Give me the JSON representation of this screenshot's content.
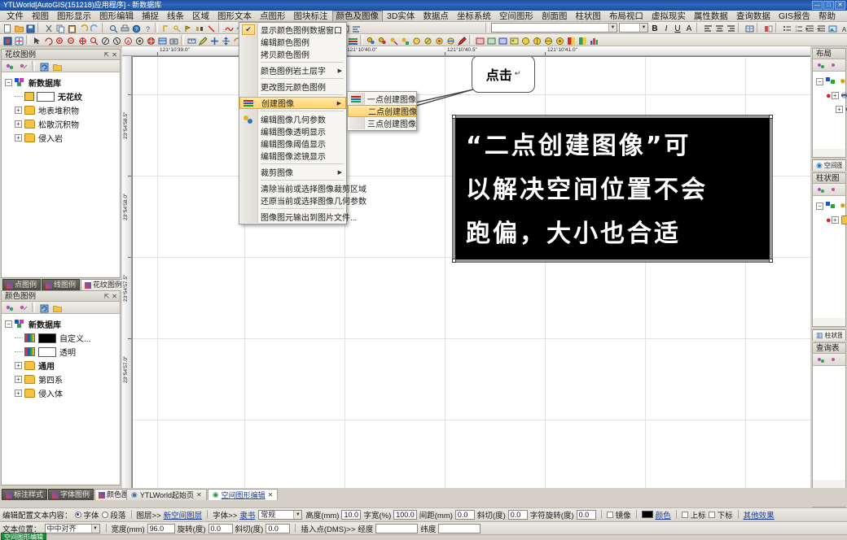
{
  "window": {
    "title": "YTLWorld[AutoGIS(151218)应用程序] - 新数据库",
    "buttons": [
      "—",
      "□",
      "✕"
    ]
  },
  "menubar": {
    "items": [
      {
        "label": "文件",
        "active": false
      },
      {
        "label": "视图",
        "active": false
      },
      {
        "label": "图形显示",
        "active": false
      },
      {
        "label": "图形编辑",
        "active": false
      },
      {
        "label": "捕捉",
        "active": false
      },
      {
        "label": "线条",
        "active": false
      },
      {
        "label": "区域",
        "active": false
      },
      {
        "label": "图形文本",
        "active": false
      },
      {
        "label": "点图形",
        "active": false
      },
      {
        "label": "图块标注",
        "active": false
      },
      {
        "label": "颜色及图像",
        "active": true
      },
      {
        "label": "3D实体",
        "active": false
      },
      {
        "label": "数据点",
        "active": false
      },
      {
        "label": "坐标系统",
        "active": false
      },
      {
        "label": "空间图形",
        "active": false
      },
      {
        "label": "剖面图",
        "active": false
      },
      {
        "label": "柱状图",
        "active": false
      },
      {
        "label": "布局视口",
        "active": false
      },
      {
        "label": "虚拟现实",
        "active": false
      },
      {
        "label": "属性数据",
        "active": false
      },
      {
        "label": "查询数据",
        "active": false
      },
      {
        "label": "GIS报告",
        "active": false
      },
      {
        "label": "帮助",
        "active": false
      }
    ]
  },
  "menu": {
    "title": "颜色及图像",
    "items": [
      {
        "label": "显示颜色图例数据窗口",
        "checked": true,
        "submenu": false,
        "icon": null
      },
      {
        "label": "编辑颜色图例",
        "checked": false,
        "submenu": false,
        "icon": null
      },
      {
        "label": "拷贝颜色图例",
        "checked": false,
        "submenu": false,
        "icon": null
      },
      {
        "separator": true
      },
      {
        "label": "颜色图例岩土层字",
        "checked": false,
        "submenu": true,
        "icon": null
      },
      {
        "separator": true
      },
      {
        "label": "更改图元颜色图例",
        "checked": false,
        "submenu": false,
        "icon": null
      },
      {
        "separator": true
      },
      {
        "label": "创建图像",
        "checked": false,
        "submenu": true,
        "icon": "image-icon",
        "selected": true
      },
      {
        "separator": true
      },
      {
        "label": "编辑图像几何参数",
        "checked": false,
        "submenu": false,
        "icon": "image-geom-icon"
      },
      {
        "label": "编辑图像透明显示",
        "checked": false,
        "submenu": false,
        "icon": null
      },
      {
        "label": "编辑图像阈值显示",
        "checked": false,
        "submenu": false,
        "icon": null
      },
      {
        "label": "编辑图像滤镜显示",
        "checked": false,
        "submenu": false,
        "icon": null
      },
      {
        "separator": true
      },
      {
        "label": "裁剪图像",
        "checked": false,
        "submenu": true,
        "icon": null
      },
      {
        "separator": true
      },
      {
        "label": "清除当前或选择图像裁剪区域",
        "checked": false,
        "submenu": false,
        "icon": null
      },
      {
        "label": "还原当前或选择图像几何参数",
        "checked": false,
        "submenu": false,
        "icon": null
      },
      {
        "separator": true
      },
      {
        "label": "图像图元输出到图片文件...",
        "checked": false,
        "submenu": false,
        "icon": null
      }
    ],
    "submenu": {
      "items": [
        {
          "label": "一点创建图像",
          "icon": "create-image-icon",
          "selected": false
        },
        {
          "label": "二点创建图像",
          "icon": null,
          "selected": true
        },
        {
          "label": "三点创建图像",
          "icon": null,
          "selected": false
        }
      ]
    }
  },
  "callout": {
    "text": "点击",
    "mark": "↵"
  },
  "canvas_image": {
    "lines": [
      "“二点创建图像”可",
      "以解决空间位置不会",
      "跑偏，大小也合适"
    ],
    "background": "#000000",
    "text_color": "#ffffff"
  },
  "ruler": {
    "horizontal": [
      "121°10'39.0\"",
      "121°10'39.0\"",
      "121°10'40.0\"",
      "121°10'40.5\"",
      "121°10'41.0\""
    ],
    "vertical": [
      "23°54'58.5\"",
      "23°54'58.0\"",
      "23°54'57.5\"",
      "23°54'57.0\""
    ]
  },
  "left_panel_top": {
    "title": "花纹图例",
    "tree": [
      {
        "label": "新数据库",
        "level": 0,
        "type": "db",
        "expanded": true,
        "bold": true
      },
      {
        "label": "无花纹",
        "level": 1,
        "type": "swatch",
        "swatch": "#ffffff",
        "bold": true
      },
      {
        "label": "地表堆积物",
        "level": 1,
        "type": "folder",
        "expanded": false
      },
      {
        "label": "松散沉积物",
        "level": 1,
        "type": "folder",
        "expanded": false
      },
      {
        "label": "侵入岩",
        "level": 1,
        "type": "folder",
        "expanded": false
      }
    ]
  },
  "left_panel_tabs": [
    {
      "label": "点图例",
      "selected": false
    },
    {
      "label": "线图例",
      "selected": false
    },
    {
      "label": "花纹图例",
      "selected": true
    }
  ],
  "left_panel_bottom": {
    "title": "颜色图例",
    "tree": [
      {
        "label": "新数据库",
        "level": 0,
        "type": "db",
        "expanded": true,
        "bold": true
      },
      {
        "label": "自定义...",
        "level": 1,
        "type": "legend",
        "swatch": "#000000"
      },
      {
        "label": "透明",
        "level": 1,
        "type": "legend",
        "swatch": "#ffffff"
      },
      {
        "label": "通用",
        "level": 1,
        "type": "folder",
        "expanded": false,
        "bold": true
      },
      {
        "label": "第四系",
        "level": 1,
        "type": "folder",
        "expanded": false
      },
      {
        "label": "侵入体",
        "level": 1,
        "type": "folder",
        "expanded": false
      }
    ]
  },
  "left_panel_bottom_tabs": [
    {
      "label": "标注样式",
      "selected": false
    },
    {
      "label": "字体图例",
      "selected": false
    },
    {
      "label": "颜色图例",
      "selected": true
    }
  ],
  "right_panels": [
    {
      "title": "布局",
      "tab": null
    },
    {
      "title": null,
      "tab": "空间图形"
    },
    {
      "title": "柱状图",
      "tab": "柱状图"
    },
    {
      "title": "查询表",
      "tab": null
    }
  ],
  "doc_tabs": [
    {
      "label": "YTLWorld起始页",
      "selected": false,
      "close": "✕"
    },
    {
      "label": "空间图形编辑",
      "selected": true,
      "close": "✕"
    }
  ],
  "format_bar_1": {
    "prefix": "编辑配置文本内容：",
    "radio1": "字体",
    "radio2": "段落",
    "layer_label": "图层>>",
    "layer_value": "新空间图层",
    "font_label": "字体>>",
    "font_value": "隶书",
    "style_value": "常规",
    "height_label": "高度(mm)",
    "height_value": "10.0",
    "width_label": "字宽(%)",
    "width_value": "100.0",
    "spacing_label": "间距(mm)",
    "spacing_value": "0.0",
    "slant_label": "斜切(度)",
    "slant_value": "0.0",
    "charrot_label": "字符旋转(度)",
    "charrot_value": "0.0",
    "mirror_label": "镜像",
    "color_label": "颜色",
    "color_value": "#000000",
    "superscript_label": "上标",
    "subscript_label": "下标",
    "other_label": "其他效果"
  },
  "format_bar_2": {
    "prefix": "文本位置：",
    "align_value": "中中对齐",
    "width_label": "宽度(mm)",
    "width_value": "96.0",
    "rotate_label": "旋转(度)",
    "rotate_value": "0.0",
    "slant_label": "斜切(度)",
    "slant_value": "0.0",
    "insert_label": "插入点(DMS)>>",
    "lon_label": "经度",
    "lon_value": "",
    "lat_label": "纬度",
    "lat_value": ""
  },
  "status": {
    "chip": "空间图形编辑"
  },
  "colors": {
    "accent": "#1a3d9c",
    "menu_highlight": "#ffd36b",
    "title_bar": "#1f4e9c",
    "panel_bg": "#f4f2ee"
  }
}
